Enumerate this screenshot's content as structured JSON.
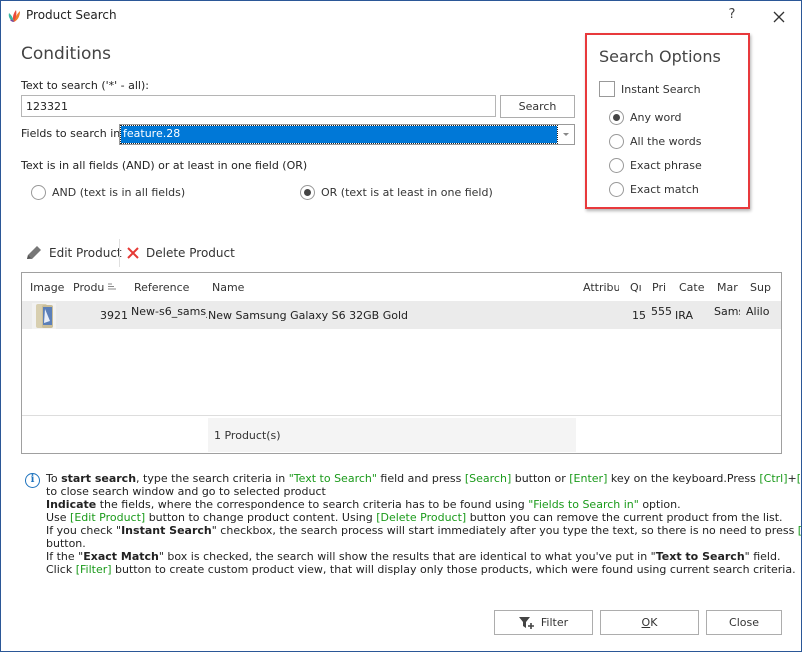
{
  "window": {
    "title": "Product Search",
    "help_label": "?",
    "close_label": "✕"
  },
  "conditions": {
    "heading": "Conditions",
    "text_label": "Text to search ('*' - all):",
    "text_value": "123321",
    "search_button": "Search",
    "fields_label": "Fields to search in",
    "fields_value": "feature.28",
    "andor_label": "Text is in all fields (AND) or at least in one field (OR)",
    "and_option": "AND (text is in all fields)",
    "or_option": "OR (text is at least in one field)",
    "selected_mode": "OR"
  },
  "search_options": {
    "heading": "Search Options",
    "instant_search_label": "Instant Search",
    "instant_search_checked": false,
    "options": [
      "Any word",
      "All the words",
      "Exact phrase",
      "Exact match"
    ],
    "selected": "Any word",
    "highlight_color": "#e8393c"
  },
  "toolbar": {
    "edit_label": "Edit Product",
    "delete_label": "Delete Product"
  },
  "grid": {
    "columns": [
      "Image",
      "Produ",
      "Reference",
      "Name",
      "Attribu",
      "Qı",
      "Pri",
      "Cate",
      "Mar",
      "Sup"
    ],
    "rows": [
      {
        "image": "Samsung Galaxy S6 thumbnail",
        "product_id": "3921",
        "reference": "New-s6_sams_",
        "name": "New Samsung Galaxy S6 32GB Gold",
        "attribute": "",
        "quantity": "15",
        "price": "555.",
        "category": "IRA",
        "manufacturer": "Sams",
        "supplier": "Alilo"
      }
    ],
    "footer": "1 Product(s)"
  },
  "info": {
    "lines": [
      [
        [
          "To ",
          ""
        ],
        [
          "start search",
          "b"
        ],
        [
          ", type the search criteria in ",
          ""
        ],
        [
          "\"Text to Search\"",
          "g"
        ],
        [
          " field and press ",
          ""
        ],
        [
          "[Search]",
          "g"
        ],
        [
          " button or ",
          ""
        ],
        [
          "[Enter]",
          "g"
        ],
        [
          " key on the keyboard.Press ",
          ""
        ],
        [
          "[Ctrl]",
          "g"
        ],
        [
          "+",
          ""
        ],
        [
          "[Enter]",
          "g"
        ]
      ],
      [
        [
          "to close search window and go to selected product",
          ""
        ]
      ],
      [
        [
          "Indicate",
          "b"
        ],
        [
          " the fields, where the correspondence to search criteria has to be found using ",
          ""
        ],
        [
          "\"Fields to Search in\"",
          "g"
        ],
        [
          " option.",
          ""
        ]
      ],
      [
        [
          "Use ",
          ""
        ],
        [
          "[Edit Product]",
          "g"
        ],
        [
          " button to change product content. Using ",
          ""
        ],
        [
          "[Delete Product]",
          "g"
        ],
        [
          " button you can remove the current product from the list.",
          ""
        ]
      ],
      [
        [
          "If you check \"",
          ""
        ],
        [
          "Instant Search",
          "b"
        ],
        [
          "\" checkbox, the search process will start immediately after you type the text, so there is no need to press ",
          ""
        ],
        [
          "[Search]",
          "g"
        ]
      ],
      [
        [
          "button.",
          ""
        ]
      ],
      [
        [
          "If the \"",
          ""
        ],
        [
          "Exact Match",
          "b"
        ],
        [
          "\" box is checked, the search will show the results that are identical to what you've put in \"",
          ""
        ],
        [
          "Text to Search",
          "b"
        ],
        [
          "\" field.",
          ""
        ]
      ],
      [
        [
          "Click ",
          ""
        ],
        [
          "[Filter]",
          "g"
        ],
        [
          " button to create custom product view, that will display only those products, which were found using current search criteria.",
          ""
        ]
      ]
    ]
  },
  "buttons": {
    "filter": "Filter",
    "ok_mnemonic": "O",
    "ok_rest": "K",
    "close": "Close"
  }
}
